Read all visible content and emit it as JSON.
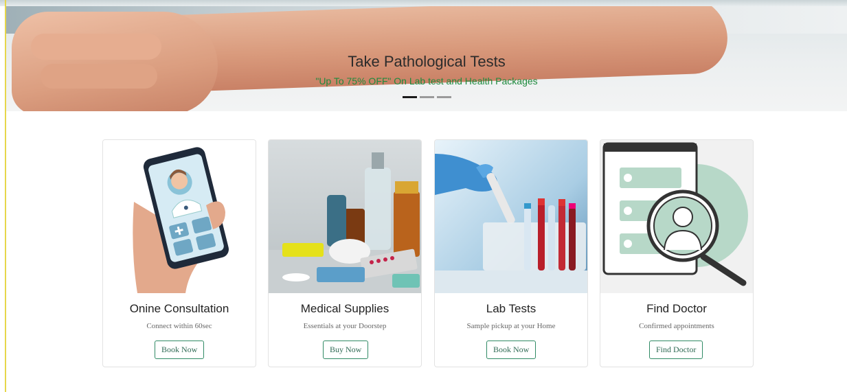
{
  "hero": {
    "title": "Take Pathological Tests",
    "subtitle": "\"Up To 75% OFF\" On Lab test and Health Packages",
    "slides": 3,
    "active_slide": 1
  },
  "cards": [
    {
      "title": "Onine Consultation",
      "text": "Connect within 60sec",
      "button": "Book Now"
    },
    {
      "title": "Medical Supplies",
      "text": "Essentials at your Doorstep",
      "button": "Buy Now"
    },
    {
      "title": "Lab Tests",
      "text": "Sample pickup at your Home",
      "button": "Book Now"
    },
    {
      "title": "Find Doctor",
      "text": "Confirmed appointments",
      "button": "Find Doctor"
    }
  ],
  "colors": {
    "accent_green": "#1d8a3d",
    "button_border": "#2f8a64"
  }
}
